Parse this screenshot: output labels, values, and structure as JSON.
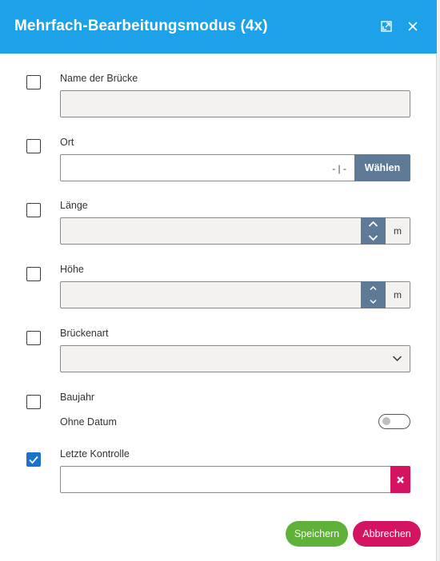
{
  "dialog": {
    "title": "Mehrfach-Bearbeitungsmodus (4x)",
    "expand_icon": "expand-icon",
    "close_icon": "close-icon"
  },
  "fields": {
    "name": {
      "label": "Name der Brücke",
      "value": "",
      "checked": false
    },
    "ort": {
      "label": "Ort",
      "value": "",
      "suffix": "- | -",
      "button_label": "Wählen",
      "checked": false
    },
    "laenge": {
      "label": "Länge",
      "value": "",
      "unit": "m",
      "checked": false
    },
    "hoehe": {
      "label": "Höhe",
      "value": "",
      "unit": "m",
      "checked": false
    },
    "brueckenart": {
      "label": "Brückenart",
      "selected": "",
      "checked": false
    },
    "baujahr": {
      "label": "Baujahr",
      "toggle_label": "Ohne Datum",
      "toggle_on": false,
      "checked": false
    },
    "letzte_kontrolle": {
      "label": "Letzte Kontrolle",
      "value": "",
      "checked": true
    }
  },
  "footer": {
    "save_label": "Speichern",
    "cancel_label": "Abbrechen"
  },
  "colors": {
    "header": "#1da1e8",
    "accent_button": "#5e7a96",
    "save": "#5fb139",
    "cancel": "#d51461",
    "checkbox_checked": "#1a73c9"
  }
}
